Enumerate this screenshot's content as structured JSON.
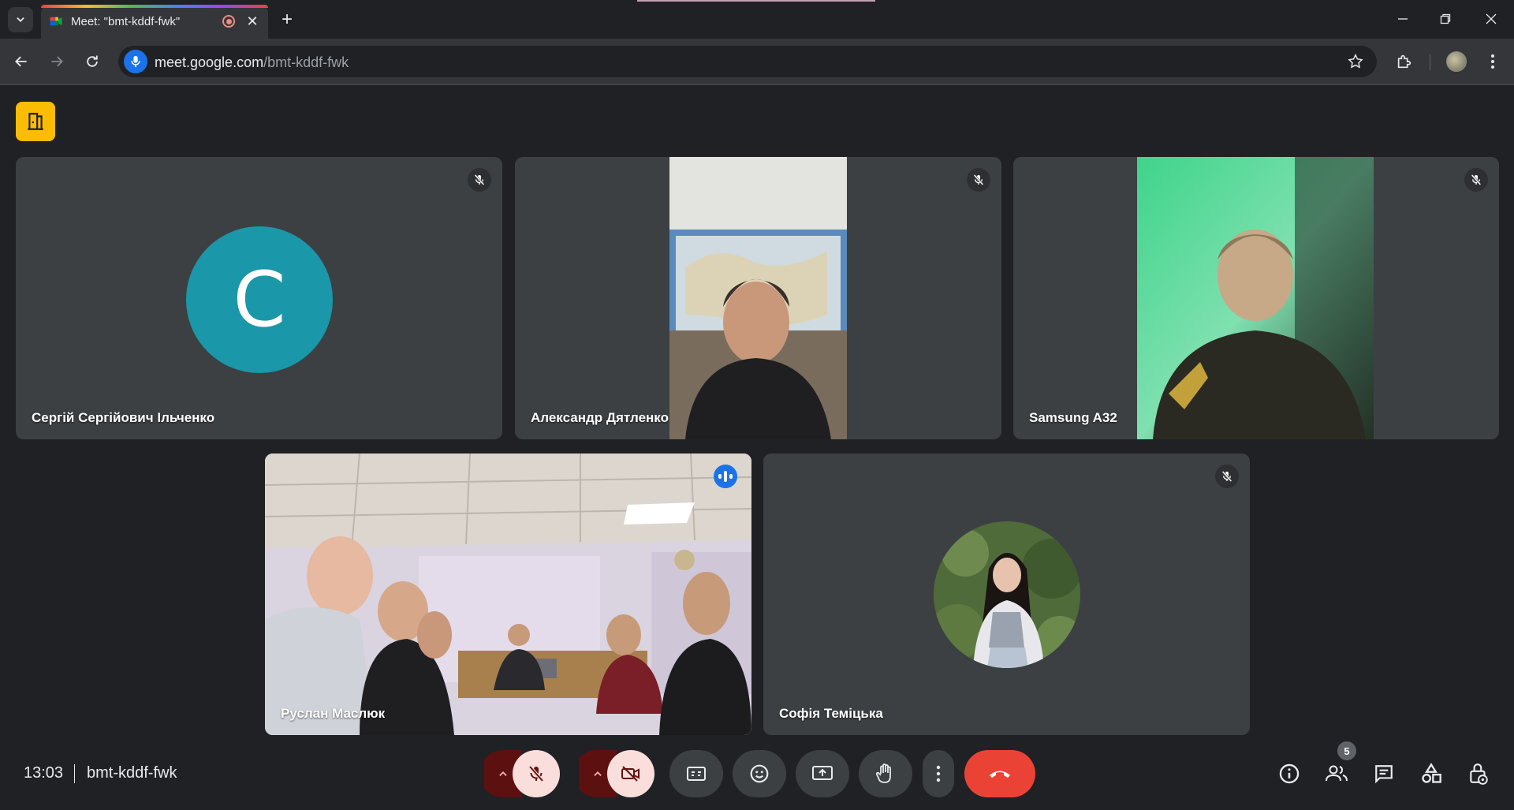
{
  "browser": {
    "tab_title": "Meet: \"bmt-kddf-fwk\"",
    "url_host": "meet.google.com",
    "url_path": "/bmt-kddf-fwk"
  },
  "meeting": {
    "time": "13:03",
    "code": "bmt-kddf-fwk",
    "participant_count": "5"
  },
  "participants": [
    {
      "name": "Сергій Сергійович Ільченко",
      "avatar_letter": "С",
      "avatar_color": "#1a97a8",
      "muted": true,
      "video": false
    },
    {
      "name": "Александр Дятленко",
      "muted": true,
      "video": true
    },
    {
      "name": "Samsung A32",
      "muted": true,
      "video": true
    },
    {
      "name": "Руслан Маслюк",
      "muted": false,
      "speaking": true,
      "video": true
    },
    {
      "name": "Софія Теміцька",
      "muted": true,
      "video": false
    }
  ],
  "colors": {
    "background": "#202124",
    "tile": "#3c4043",
    "accent": "#8ab4f8",
    "end_call": "#ea4335",
    "muted_control": "#f9dedc"
  },
  "icons": {
    "meet_logo": "door-exit-icon",
    "mic": "mic-off-icon",
    "camera": "videocam-off-icon",
    "captions": "closed-captions-icon",
    "emoji": "emoji-icon",
    "present": "present-screen-icon",
    "hand": "raise-hand-icon",
    "more": "more-vert-icon",
    "end": "call-end-icon",
    "info": "info-icon",
    "people": "people-icon",
    "chat": "chat-icon",
    "activities": "activities-icon",
    "host": "host-controls-icon"
  }
}
